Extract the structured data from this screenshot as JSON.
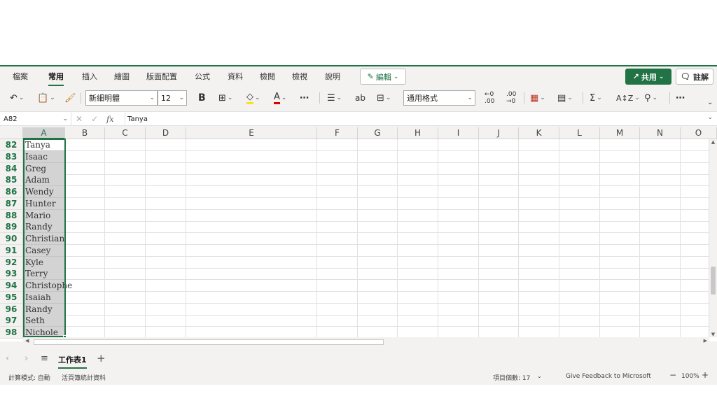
{
  "ribbon": {
    "tabs": [
      "檔案",
      "常用",
      "插入",
      "繪圖",
      "版面配置",
      "公式",
      "資料",
      "檢閱",
      "檢視",
      "說明"
    ],
    "active_tab": "常用",
    "edit_label": "編輯",
    "share_label": "共用",
    "comment_label": "註解"
  },
  "toolbar": {
    "font_name": "新細明體",
    "font_size": "12",
    "number_format": "通用格式",
    "bold_label": "B"
  },
  "formula_bar": {
    "name_box": "A82",
    "fx_label": "fx",
    "value": "Tanya"
  },
  "columns": [
    "A",
    "B",
    "C",
    "D",
    "E",
    "F",
    "G",
    "H",
    "I",
    "J",
    "K",
    "L",
    "M",
    "N",
    "O"
  ],
  "rows": [
    {
      "num": "82",
      "a": "Tanya"
    },
    {
      "num": "83",
      "a": "Isaac"
    },
    {
      "num": "84",
      "a": "Greg"
    },
    {
      "num": "85",
      "a": "Adam"
    },
    {
      "num": "86",
      "a": "Wendy"
    },
    {
      "num": "87",
      "a": "Hunter"
    },
    {
      "num": "88",
      "a": "Mario"
    },
    {
      "num": "89",
      "a": "Randy"
    },
    {
      "num": "90",
      "a": "Christian"
    },
    {
      "num": "91",
      "a": "Casey"
    },
    {
      "num": "92",
      "a": "Kyle"
    },
    {
      "num": "93",
      "a": "Terry"
    },
    {
      "num": "94",
      "a": "Christophe"
    },
    {
      "num": "95",
      "a": "Isaiah"
    },
    {
      "num": "96",
      "a": "Randy"
    },
    {
      "num": "97",
      "a": "Seth"
    },
    {
      "num": "98",
      "a": "Nichole"
    }
  ],
  "sheets": {
    "active": "工作表1",
    "add_label": "+"
  },
  "status": {
    "calc_mode": "計算模式: 自動",
    "workbook_stats": "活頁簿統計資料",
    "count": "項目個數: 17",
    "feedback": "Give Feedback to Microsoft",
    "zoom": "100%"
  },
  "colors": {
    "accent": "#217346",
    "selection": "#d3d3d3"
  }
}
